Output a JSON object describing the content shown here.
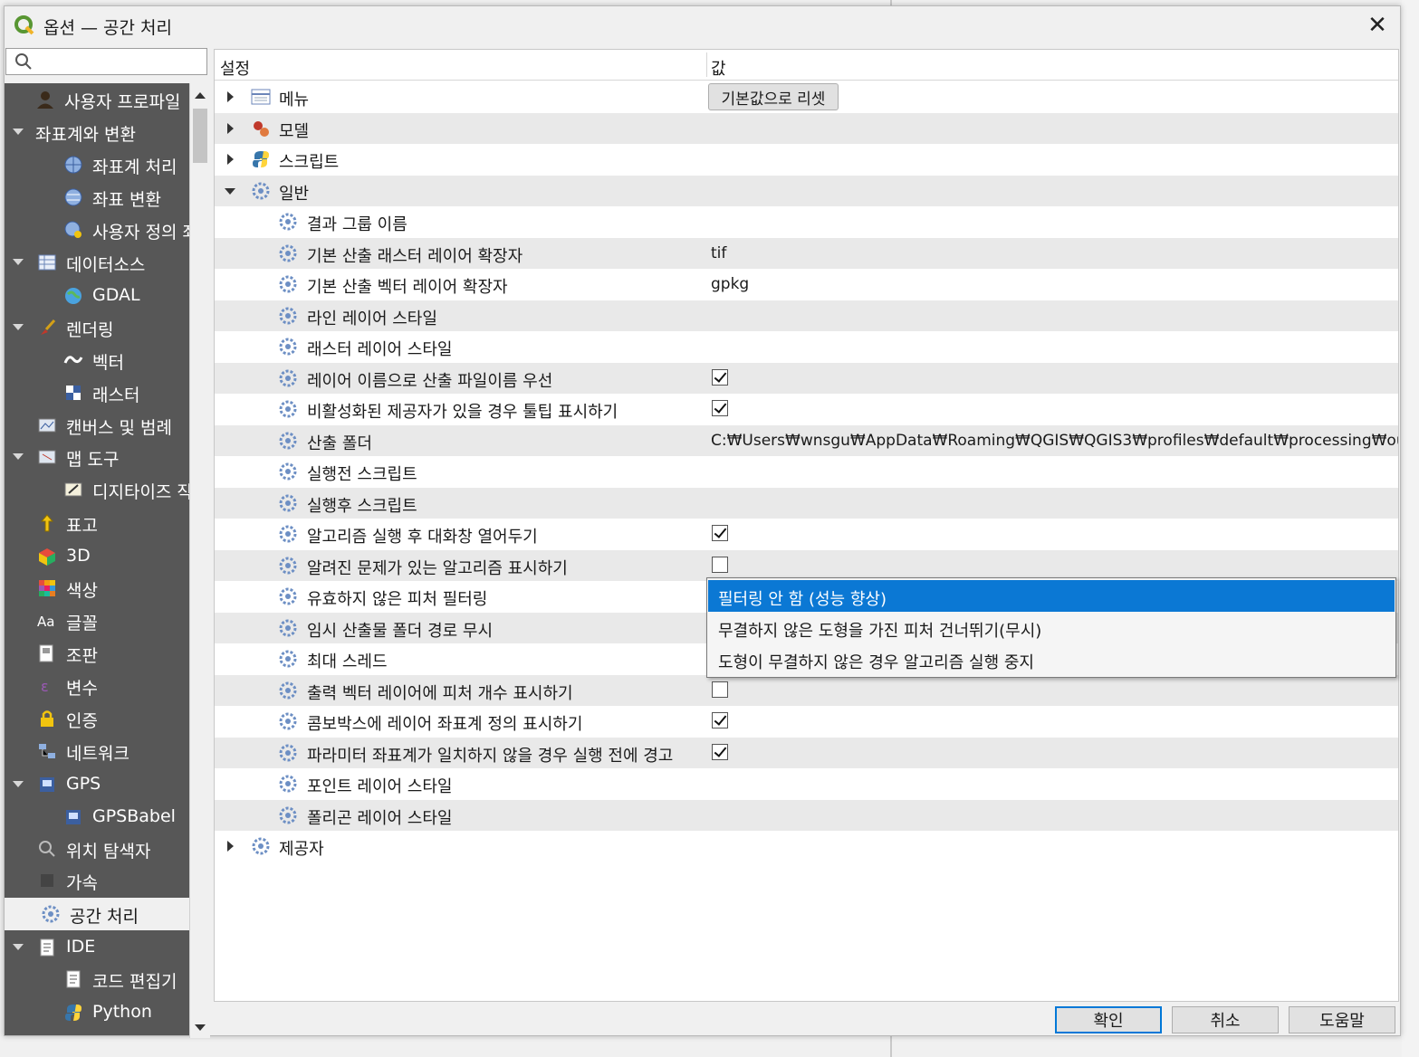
{
  "window": {
    "title": "옵션 — 공간 처리"
  },
  "search": {
    "placeholder": ""
  },
  "sidebar": {
    "items": [
      {
        "label": "사용자 프로파일",
        "icon": "user-icon"
      },
      {
        "label": "좌표계와 변환",
        "icon": "none"
      },
      {
        "label": "좌표계 처리",
        "icon": "globe-icon"
      },
      {
        "label": "좌표 변환",
        "icon": "globe-transform-icon"
      },
      {
        "label": "사용자 정의 좌",
        "icon": "globe-custom-icon"
      },
      {
        "label": "데이터소스",
        "icon": "table-icon"
      },
      {
        "label": "GDAL",
        "icon": "gdal-icon"
      },
      {
        "label": "렌더링",
        "icon": "brush-icon"
      },
      {
        "label": "벡터",
        "icon": "vector-icon"
      },
      {
        "label": "래스터",
        "icon": "raster-icon"
      },
      {
        "label": "캔버스 및 범례",
        "icon": "canvas-icon"
      },
      {
        "label": "맵 도구",
        "icon": "map-tools-icon"
      },
      {
        "label": "디지타이즈 작",
        "icon": "digitize-icon"
      },
      {
        "label": "표고",
        "icon": "elevation-icon"
      },
      {
        "label": "3D",
        "icon": "cube-icon"
      },
      {
        "label": "색상",
        "icon": "colors-icon"
      },
      {
        "label": "글꼴",
        "icon": "font-icon"
      },
      {
        "label": "조판",
        "icon": "layout-icon"
      },
      {
        "label": "변수",
        "icon": "variables-icon"
      },
      {
        "label": "인증",
        "icon": "lock-icon"
      },
      {
        "label": "네트워크",
        "icon": "network-icon"
      },
      {
        "label": "GPS",
        "icon": "gps-icon"
      },
      {
        "label": "GPSBabel",
        "icon": "gpsbabel-icon"
      },
      {
        "label": "위치 탐색자",
        "icon": "search-icon"
      },
      {
        "label": "가속",
        "icon": "chip-icon"
      },
      {
        "label": "공간 처리",
        "icon": "gear-icon"
      },
      {
        "label": "IDE",
        "icon": "ide-icon"
      },
      {
        "label": "코드 편집기",
        "icon": "code-editor-icon"
      },
      {
        "label": "Python",
        "icon": "python-icon"
      }
    ]
  },
  "tree": {
    "header": {
      "setting": "설정",
      "value": "값"
    },
    "rows": [
      {
        "name": "메뉴",
        "value": ""
      },
      {
        "name": "모델",
        "value": ""
      },
      {
        "name": "스크립트",
        "value": ""
      },
      {
        "name": "일반",
        "value": ""
      },
      {
        "name": "결과 그룹 이름",
        "value": ""
      },
      {
        "name": "기본 산출 래스터 레이어 확장자",
        "value": "tif"
      },
      {
        "name": "기본 산출 벡터 레이어 확장자",
        "value": "gpkg"
      },
      {
        "name": "라인 레이어 스타일",
        "value": ""
      },
      {
        "name": "래스터 레이어 스타일",
        "value": ""
      },
      {
        "name": "레이어 이름으로 산출 파일이름 우선",
        "value": "checked"
      },
      {
        "name": "비활성화된 제공자가 있을 경우 툴팁 표시하기",
        "value": "checked"
      },
      {
        "name": "산출 폴더",
        "value": "C:₩Users₩wnsgu₩AppData₩Roaming₩QGIS₩QGIS3₩profiles₩default₩processing₩outputs"
      },
      {
        "name": "실행전 스크립트",
        "value": ""
      },
      {
        "name": "실행후 스크립트",
        "value": ""
      },
      {
        "name": "알고리즘 실행 후 대화창 열어두기",
        "value": "checked"
      },
      {
        "name": "알려진 문제가 있는 알고리즘 표시하기",
        "value": "unchecked"
      },
      {
        "name": "유효하지 않은 피처 필터링",
        "value": ""
      },
      {
        "name": "임시 산출물 폴더 경로 무시",
        "value": ""
      },
      {
        "name": "최대 스레드",
        "value": ""
      },
      {
        "name": "출력 벡터 레이어에 피처 개수 표시하기",
        "value": "unchecked"
      },
      {
        "name": "콤보박스에 레이어 좌표계 정의 표시하기",
        "value": "checked"
      },
      {
        "name": "파라미터 좌표계가 일치하지 않을 경우 실행 전에 경고",
        "value": "checked"
      },
      {
        "name": "포인트 레이어 스타일",
        "value": ""
      },
      {
        "name": "폴리곤 레이어 스타일",
        "value": ""
      },
      {
        "name": "제공자",
        "value": ""
      }
    ],
    "reset_button": "기본값으로 리셋"
  },
  "dropdown": {
    "options": [
      "필터링 안 함 (성능 향상)",
      "무결하지 않은 도형을 가진 피처 건너뛰기(무시)",
      "도형이 무결하지 않은 경우 알고리즘 실행 중지"
    ],
    "selected_index": 0
  },
  "buttons": {
    "ok": "확인",
    "cancel": "취소",
    "help": "도움말"
  },
  "colors": {
    "sidebar_bg": "#575757",
    "selection": "#0b78d4",
    "primary_border": "#0078d7"
  }
}
